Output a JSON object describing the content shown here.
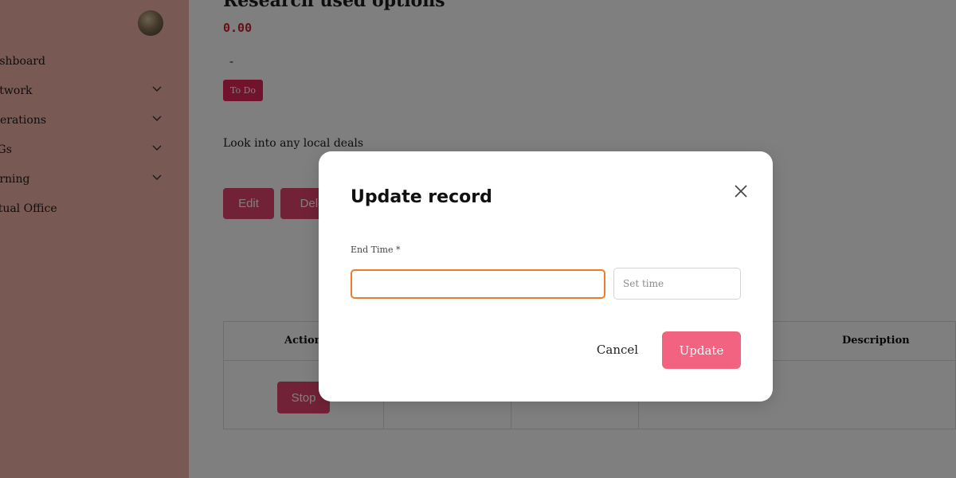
{
  "sidebar": {
    "items": [
      {
        "label": "ashboard",
        "has_chevron": false
      },
      {
        "label": "etwork",
        "has_chevron": true
      },
      {
        "label": "perations",
        "has_chevron": true
      },
      {
        "label": "IGs",
        "has_chevron": true
      },
      {
        "label": "arning",
        "has_chevron": true
      },
      {
        "label": "rtual Office",
        "has_chevron": false
      }
    ]
  },
  "main": {
    "heading": "Research used options",
    "amount": "0.00",
    "dash": "-",
    "status": "To Do",
    "description": "Look into any local deals",
    "edit_label": "Edit",
    "delete_label": "Dele",
    "table": {
      "col_action": "Action",
      "col_description": "Description",
      "stop_label": "Stop"
    }
  },
  "modal": {
    "title": "Update record",
    "field_label": "End Time *",
    "end_time_value": "",
    "time_placeholder": "Set time",
    "cancel_label": "Cancel",
    "update_label": "Update"
  },
  "colors": {
    "sidebar_bg": "#f1b2a7",
    "accent": "#f26381",
    "badge": "#e4265a",
    "focus_border": "#f07a2a"
  }
}
